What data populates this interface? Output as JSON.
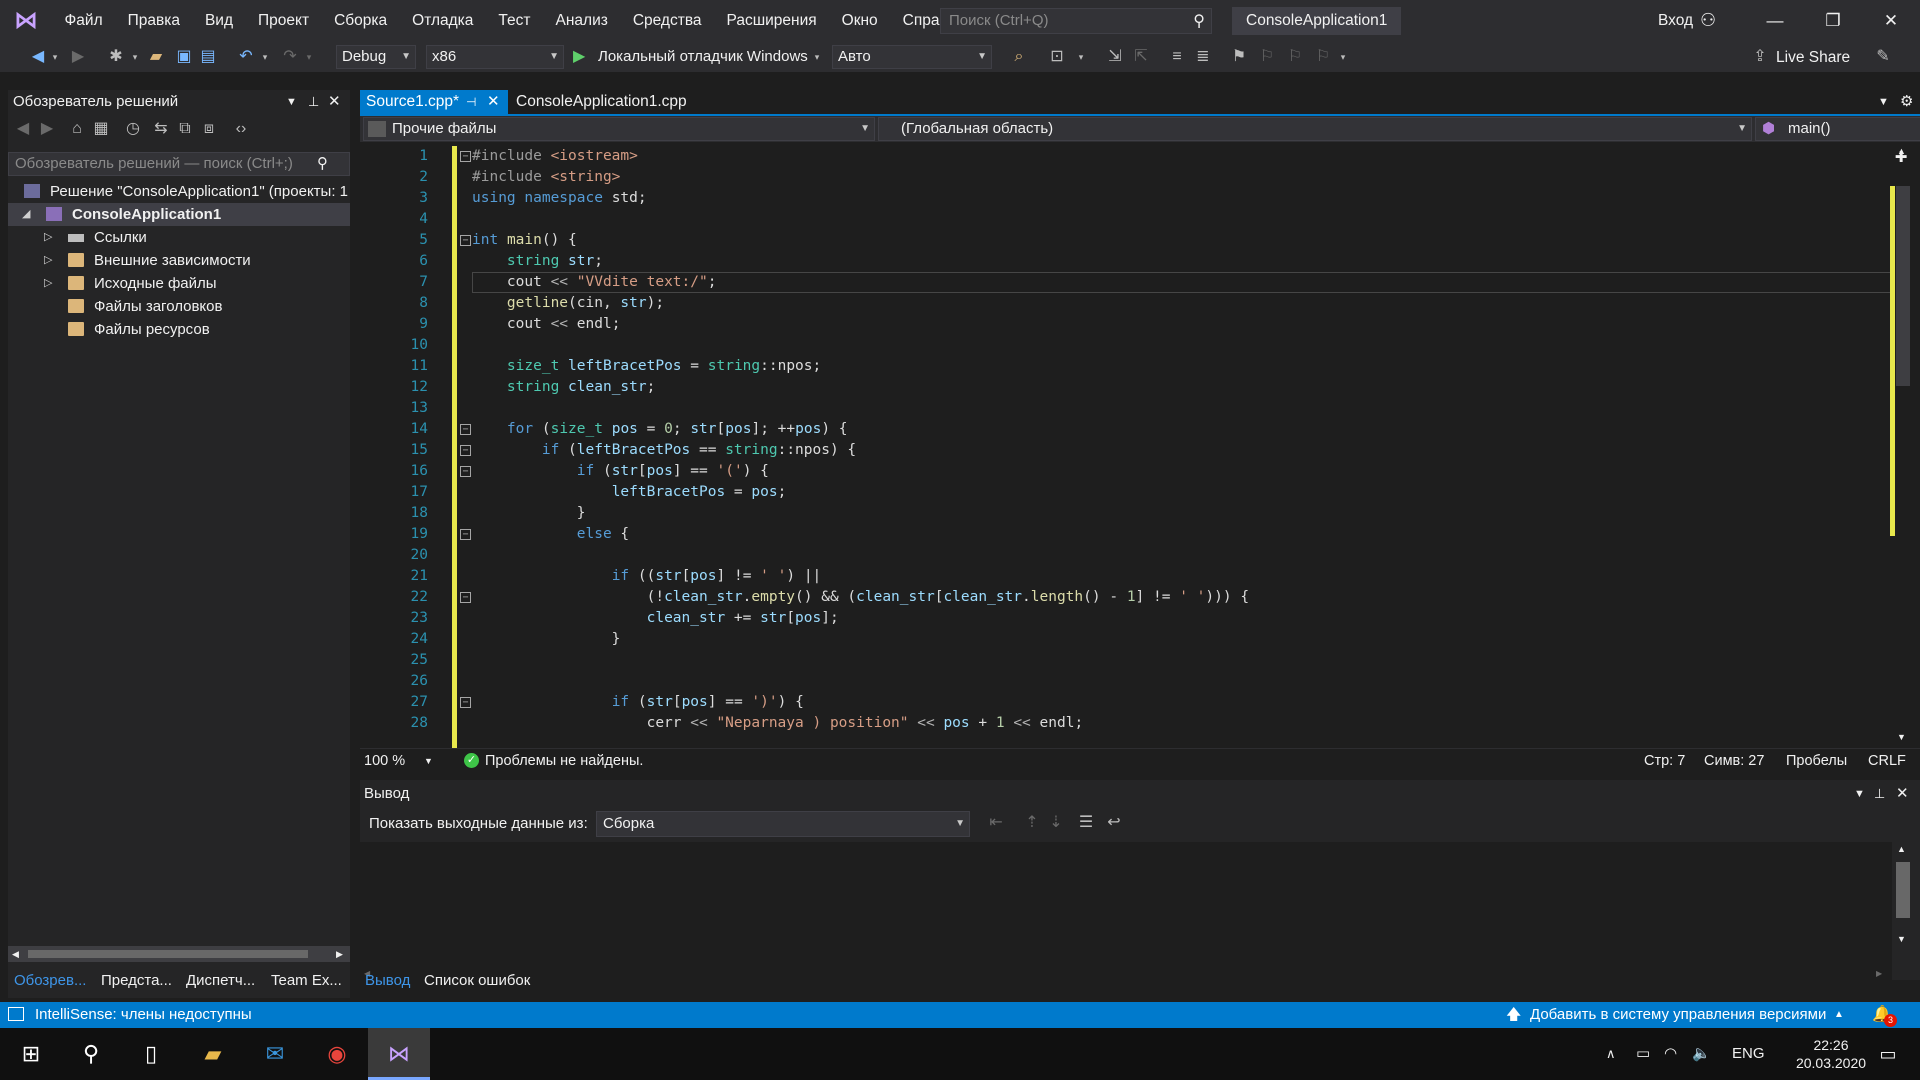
{
  "menubar": {
    "items": [
      "Файл",
      "Правка",
      "Вид",
      "Проект",
      "Сборка",
      "Отладка",
      "Тест",
      "Анализ",
      "Средства",
      "Расширения",
      "Окно",
      "Справка"
    ],
    "search_placeholder": "Поиск (Ctrl+Q)",
    "solution_badge": "ConsoleApplication1",
    "signin": "Вход"
  },
  "toolbar": {
    "config": "Debug",
    "platform": "x86",
    "run_label": "Локальный отладчик Windows",
    "run_mode": "Авто",
    "live_share": "Live Share"
  },
  "solution_explorer": {
    "title": "Обозреватель решений",
    "search_placeholder": "Обозреватель решений — поиск (Ctrl+;)",
    "solution_node": "Решение \"ConsoleApplication1\" (проекты: 1",
    "project_node": "ConsoleApplication1",
    "nodes": [
      "Ссылки",
      "Внешние зависимости",
      "Исходные файлы",
      "Файлы заголовков",
      "Файлы ресурсов"
    ],
    "bottom_tabs": [
      "Обозрев...",
      "Предста...",
      "Диспетч...",
      "Team Ex..."
    ]
  },
  "editor": {
    "tabs": [
      {
        "label": "Source1.cpp*"
      },
      {
        "label": "ConsoleApplication1.cpp"
      }
    ],
    "nav": {
      "project": "Прочие файлы",
      "scope": "(Глобальная область)",
      "member": "main()"
    },
    "line_numbers": [
      "1",
      "2",
      "3",
      "4",
      "5",
      "6",
      "7",
      "8",
      "9",
      "10",
      "11",
      "12",
      "13",
      "14",
      "15",
      "16",
      "17",
      "18",
      "19",
      "20",
      "21",
      "22",
      "23",
      "24",
      "25",
      "26",
      "27",
      "28"
    ],
    "zoom": "100 %",
    "problems": "Проблемы не найдены.",
    "cursor_line": "Стр: 7",
    "cursor_col": "Симв: 27",
    "whitespace": "Пробелы",
    "eol": "CRLF"
  },
  "output": {
    "title": "Вывод",
    "show_label": "Показать выходные данные из:",
    "source": "Сборка",
    "tabs": [
      "Вывод",
      "Список ошибок"
    ]
  },
  "statusbar": {
    "intellisense": "IntelliSense: члены недоступны",
    "vcs": "Добавить в систему управления версиями",
    "notifications": "3"
  },
  "taskbar": {
    "lang": "ENG",
    "time": "22:26",
    "date": "20.03.2020"
  },
  "colors": {
    "accent": "#007acc",
    "ide_bg": "#1e1e1e",
    "chrome": "#2d2d30",
    "panel": "#252526",
    "play": "#5fd06b",
    "changed": "#e8e84c"
  }
}
